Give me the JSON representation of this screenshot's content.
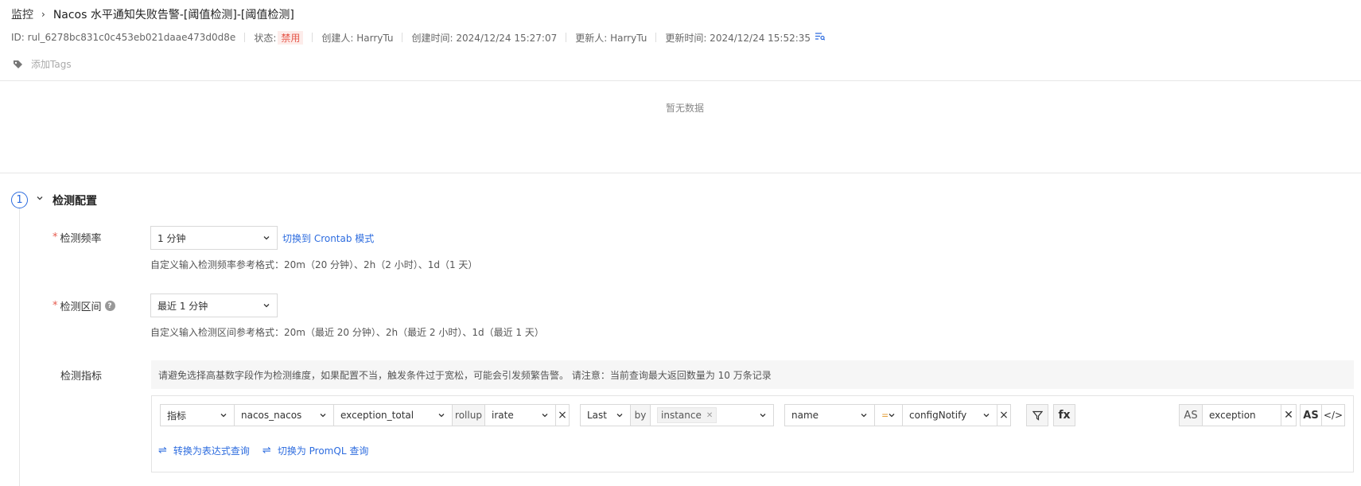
{
  "breadcrumb": {
    "parent": "监控",
    "sep": "›",
    "title": "Nacos 水平通知失败告警-[阈值检测]-[阈值检测]"
  },
  "meta": {
    "id": "ID: rul_6278bc831c0c453eb021daae473d0d8e",
    "status_label": "状态:",
    "status_value": "禁用",
    "creator": "创建人: HarryTu",
    "created_at": "创建时间: 2024/12/24 15:27:07",
    "updater": "更新人: HarryTu",
    "updated_at": "更新时间: 2024/12/24 15:52:35"
  },
  "tags": {
    "add_label": "添加Tags"
  },
  "chart": {
    "empty_text": "暂无数据"
  },
  "section": {
    "step_number": "1",
    "title": "检测配置"
  },
  "frequency": {
    "label": "检测频率",
    "value": "1 分钟",
    "switch_link": "切换到 Crontab 模式",
    "hint": "自定义输入检测频率参考格式：20m（20 分钟）、2h（2 小时）、1d（1 天）"
  },
  "interval": {
    "label": "检测区间",
    "help": "?",
    "value": "最近 1 分钟",
    "hint": "自定义输入检测区间参考格式：20m（最近 20 分钟）、2h（最近 2 小时）、1d（最近 1 天）"
  },
  "metric": {
    "label": "检测指标",
    "notice": "请避免选择高基数字段作为检测维度，如果配置不当，触发条件过于宽松，可能会引发频繁告警。 请注意：当前查询最大返回数量为 10 万条记录",
    "query": {
      "type": "指标",
      "measurement": "nacos_nacos",
      "field": "exception_total",
      "rollup_label": "rollup",
      "rollup_func": "irate",
      "agg": "Last",
      "by_label": "by",
      "by_chip": "instance",
      "filter_key": "name",
      "filter_op": "=",
      "filter_value": "configNotify",
      "filter_icon": "filter",
      "fx_label": "fx",
      "as_label": "AS",
      "alias": "exception",
      "as_button": "AS",
      "code_icon": "</>"
    },
    "actions": {
      "to_expression": "转换为表达式查询",
      "to_promql": "切换为 PromQL 查询"
    }
  }
}
